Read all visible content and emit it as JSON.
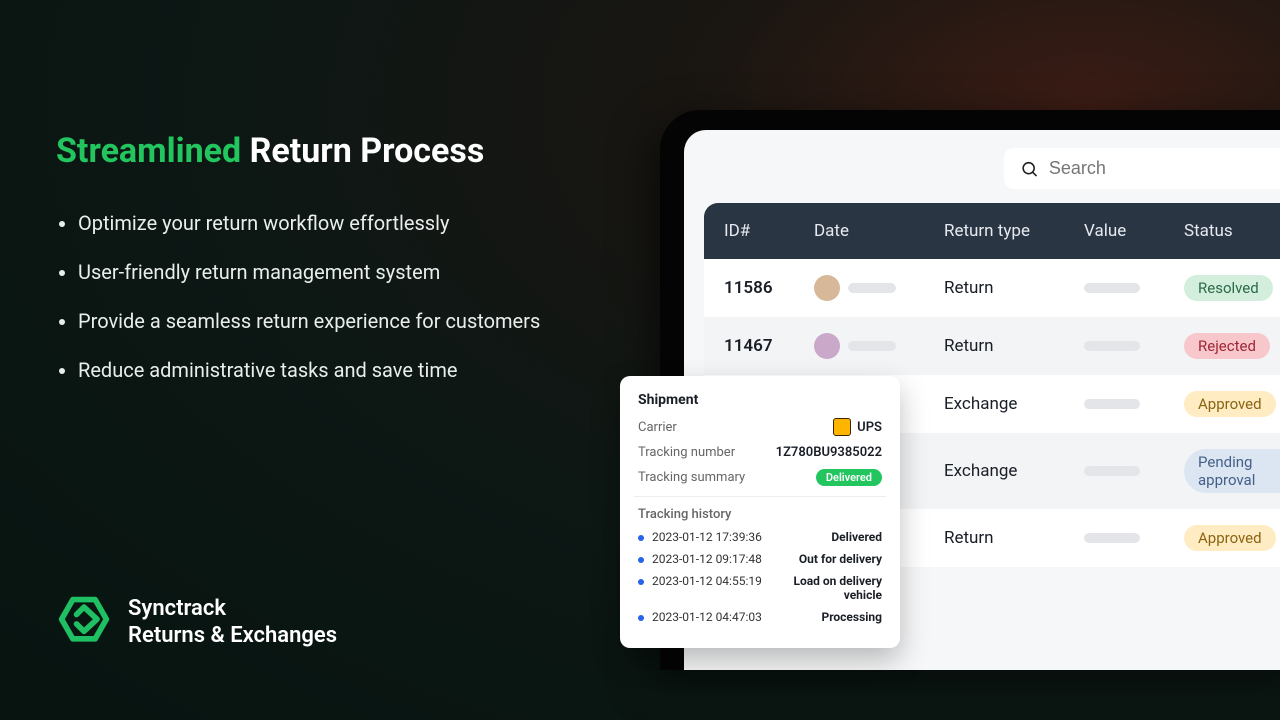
{
  "hero": {
    "accent": "Streamlined",
    "rest": "Return Process",
    "bullets": [
      "Optimize your return workflow effortlessly",
      "User-friendly return management system",
      "Provide a seamless return experience for customers",
      "Reduce administrative tasks and save time"
    ]
  },
  "brand": {
    "line1": "Synctrack",
    "line2": "Returns & Exchanges"
  },
  "search": {
    "placeholder": "Search"
  },
  "table": {
    "headers": [
      "ID#",
      "Date",
      "Return type",
      "Value",
      "Status"
    ],
    "rows": [
      {
        "id": "11586",
        "type": "Return",
        "status": "Resolved",
        "status_class": "b-resolved",
        "avatar": "a"
      },
      {
        "id": "11467",
        "type": "Return",
        "status": "Rejected",
        "status_class": "b-rejected",
        "avatar": "b"
      },
      {
        "id": "",
        "type": "Exchange",
        "status": "Approved",
        "status_class": "b-approved",
        "avatar": ""
      },
      {
        "id": "",
        "type": "Exchange",
        "status": "Pending approval",
        "status_class": "b-pending",
        "avatar": ""
      },
      {
        "id": "",
        "type": "Return",
        "status": "Approved",
        "status_class": "b-approved",
        "avatar": ""
      }
    ]
  },
  "shipment": {
    "title": "Shipment",
    "carrier_label": "Carrier",
    "carrier_value": "UPS",
    "tracking_label": "Tracking number",
    "tracking_value": "1Z780BU9385022",
    "summary_label": "Tracking summary",
    "summary_value": "Delivered",
    "history_title": "Tracking history",
    "history": [
      {
        "ts": "2023-01-12 17:39:36",
        "status": "Delivered"
      },
      {
        "ts": "2023-01-12 09:17:48",
        "status": "Out for delivery"
      },
      {
        "ts": "2023-01-12 04:55:19",
        "status": "Load on delivery vehicle"
      },
      {
        "ts": "2023-01-12 04:47:03",
        "status": "Processing"
      }
    ]
  }
}
